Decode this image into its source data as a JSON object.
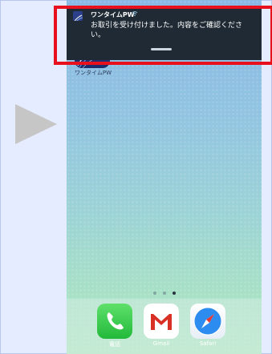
{
  "notification": {
    "app_name": "ワンタイムPW",
    "signal_icon": "wifi-signal-icon",
    "message": "お取引を受け付けました。内容をご確認ください。"
  },
  "home": {
    "app_icon_name": "onetime-pw-app-icon",
    "app_label": "ワンタイムPW",
    "page_count": 3,
    "active_page": 3
  },
  "dock": {
    "apps": [
      {
        "label": "電話",
        "icon": "phone-icon"
      },
      {
        "label": "Gmail",
        "icon": "gmail-icon"
      },
      {
        "label": "Safari",
        "icon": "safari-icon"
      }
    ]
  },
  "colors": {
    "highlight": "#e8101c",
    "notification_bg": "#1f2a34",
    "arrow": "#c6c6c6"
  }
}
